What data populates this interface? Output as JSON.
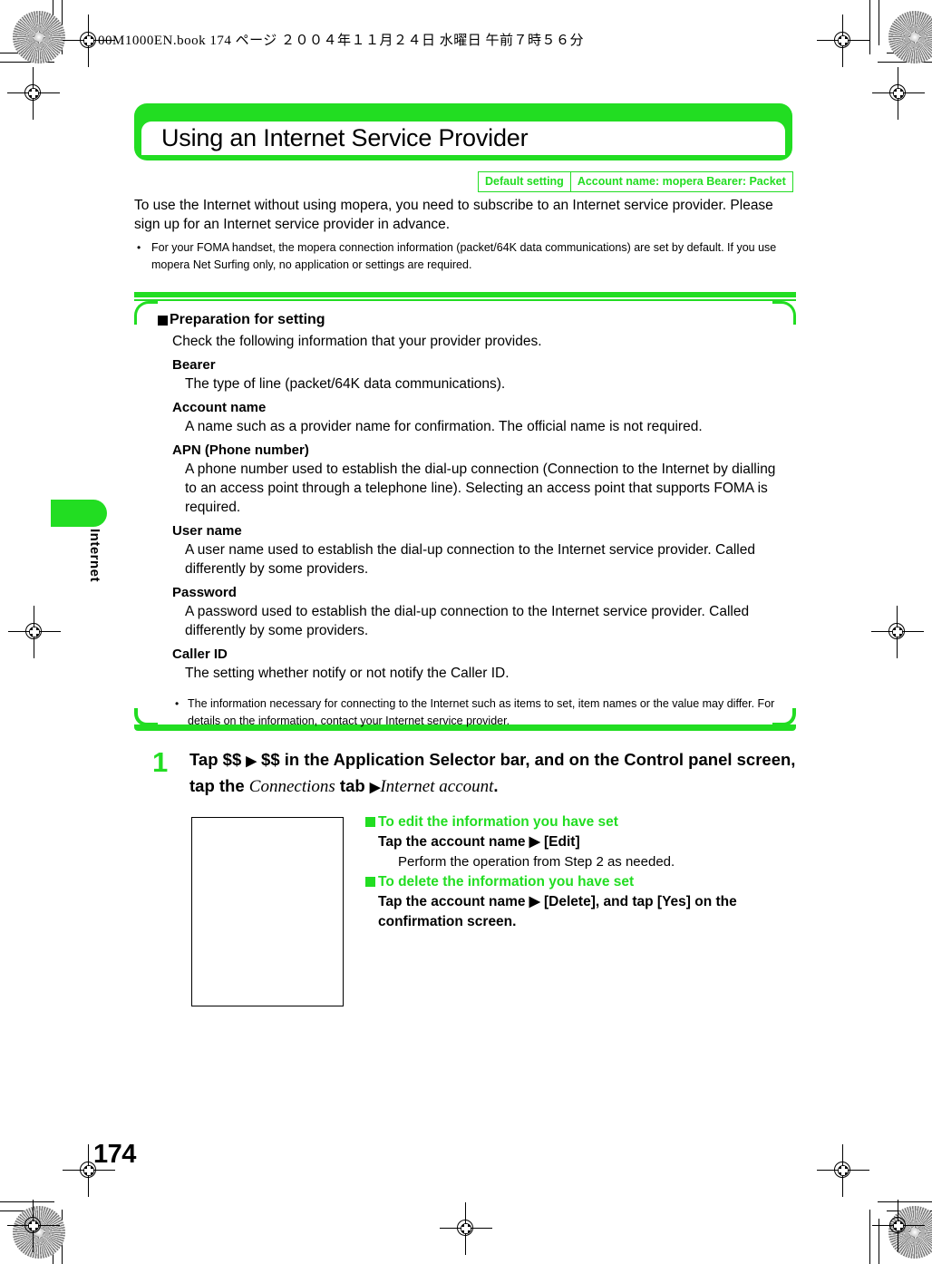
{
  "print_slug": "00M1000EN.book   174 ページ   ２００４年１１月２４日   水曜日   午前７時５６分",
  "page_number": "174",
  "chapter_tab": {
    "label": "Internet"
  },
  "title": "Using an Internet Service Provider",
  "default_setting_table": {
    "header": "Default setting",
    "value": "Account name: mopera Bearer: Packet"
  },
  "intro": {
    "paragraph": "To use the Internet without using mopera, you need to subscribe to an Internet service provider. Please sign up for an Internet service provider in advance.",
    "bullet_marker": "•",
    "bullet": "For your FOMA handset, the mopera connection information (packet/64K data communications) are set by default. If you use mopera Net Surfing only, no application or settings are required."
  },
  "preparation": {
    "heading": "Preparation for setting",
    "lead": "Check the following information that your provider provides.",
    "terms": [
      {
        "term": "Bearer",
        "definition": "The type of line (packet/64K data communications)."
      },
      {
        "term": "Account name",
        "definition": "A name such as a provider name for confirmation. The official name is not required."
      },
      {
        "term": "APN (Phone number)",
        "definition": "A phone number used to establish the dial-up connection (Connection to the Internet by dialling to an access point through a telephone line). Selecting an access point that supports FOMA is required."
      },
      {
        "term": "User name",
        "definition": "A user name used to establish the dial-up connection to the Internet service provider. Called differently by some providers."
      },
      {
        "term": "Password",
        "definition": "A password used to establish the dial-up connection to the Internet service provider. Called differently by some providers."
      },
      {
        "term": "Caller ID",
        "definition": "The setting whether notify or not notify the Caller ID."
      }
    ],
    "note_marker": "•",
    "note": "The information necessary for connecting to the Internet such as items to set, item names or the value may differ. For details on the information, contact your Internet service provider."
  },
  "step": {
    "number": "1",
    "part1": "Tap $$ ",
    "arrow1": "▶",
    "part2": " $$ in the Application Selector bar, and on the Control panel screen, tap the ",
    "emphasis1": "Connections",
    "part3": " tab ",
    "arrow2": "▶",
    "emphasis2": "Internet account",
    "part4": "."
  },
  "subsections": [
    {
      "heading": "To edit the information you have set",
      "line": "Tap the account name ▶ [Edit]",
      "detail": "Perform the operation from Step 2 as needed."
    },
    {
      "heading": "To delete the information you have set",
      "line": "Tap the account name ▶ [Delete], and tap [Yes] on the confirmation screen.",
      "detail": ""
    }
  ],
  "colors": {
    "green": "#22dd22",
    "black": "#000000",
    "white": "#ffffff"
  }
}
